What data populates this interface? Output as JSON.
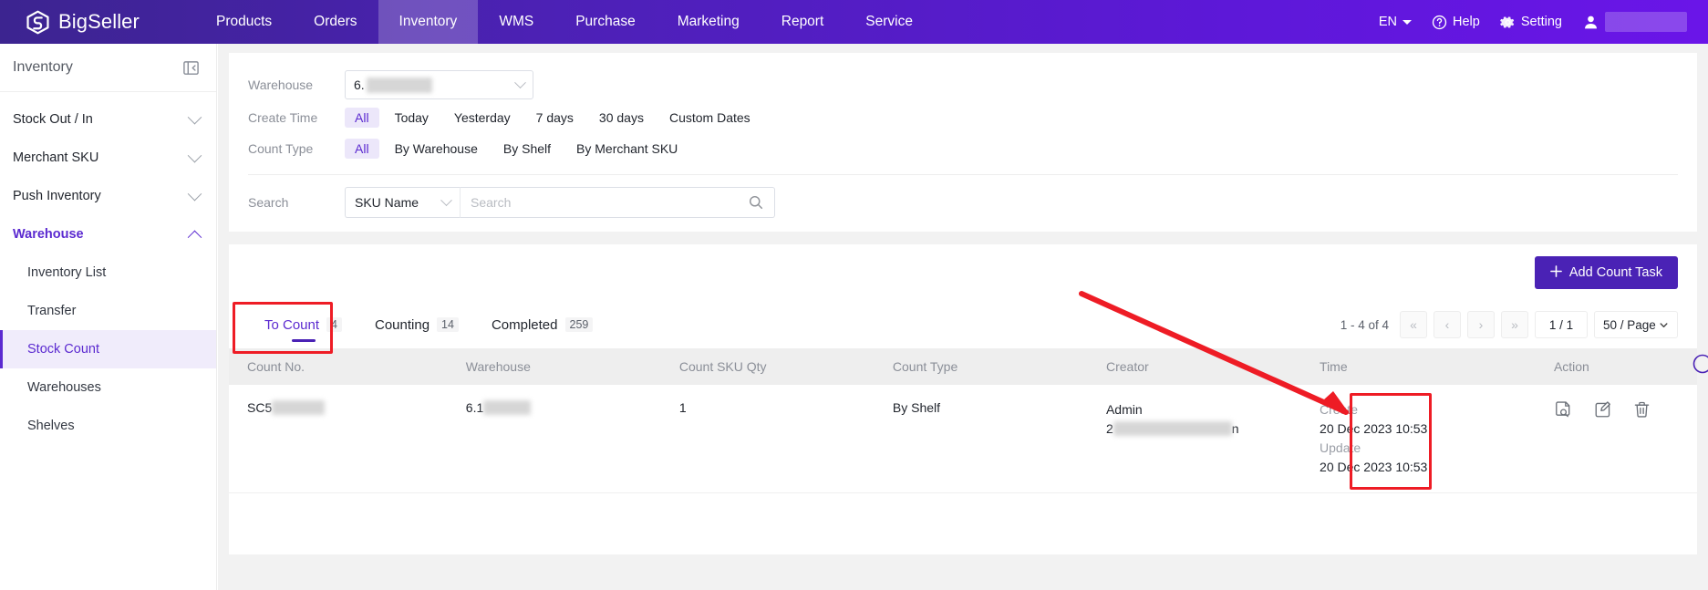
{
  "header": {
    "brand": "BigSeller",
    "brand_icon": "bigseller-logo-icon",
    "nav": [
      {
        "label": "Products",
        "active": false
      },
      {
        "label": "Orders",
        "active": false
      },
      {
        "label": "Inventory",
        "active": true
      },
      {
        "label": "WMS",
        "active": false
      },
      {
        "label": "Purchase",
        "active": false
      },
      {
        "label": "Marketing",
        "active": false
      },
      {
        "label": "Report",
        "active": false
      },
      {
        "label": "Service",
        "active": false
      }
    ],
    "language": "EN",
    "help": "Help",
    "setting": "Setting",
    "account_name": ""
  },
  "sidebar": {
    "title": "Inventory",
    "groups": [
      {
        "label": "Stock Out / In",
        "open": false
      },
      {
        "label": "Merchant SKU",
        "open": false
      },
      {
        "label": "Push Inventory",
        "open": false
      },
      {
        "label": "Warehouse",
        "open": true
      }
    ],
    "sub_items": [
      {
        "label": "Inventory List",
        "active": false
      },
      {
        "label": "Transfer",
        "active": false
      },
      {
        "label": "Stock Count",
        "active": true
      },
      {
        "label": "Warehouses",
        "active": false
      },
      {
        "label": "Shelves",
        "active": false
      }
    ]
  },
  "filters": {
    "warehouse_label": "Warehouse",
    "warehouse_value": "6.",
    "create_time_label": "Create Time",
    "create_time_options": [
      "All",
      "Today",
      "Yesterday",
      "7 days",
      "30 days",
      "Custom Dates"
    ],
    "create_time_selected": "All",
    "count_type_label": "Count Type",
    "count_type_options": [
      "All",
      "By Warehouse",
      "By Shelf",
      "By Merchant SKU"
    ],
    "count_type_selected": "All",
    "search_label": "Search",
    "search_type": "SKU Name",
    "search_placeholder": "Search",
    "search_value": ""
  },
  "toolbar": {
    "add_count_task": "Add Count Task",
    "add_icon": "plus-icon"
  },
  "tabs": [
    {
      "label": "To Count",
      "count": "4",
      "active": true
    },
    {
      "label": "Counting",
      "count": "14",
      "active": false
    },
    {
      "label": "Completed",
      "count": "259",
      "active": false
    }
  ],
  "pagination": {
    "range": "1 - 4 of 4",
    "first": "«",
    "prev": "‹",
    "next": "›",
    "last": "»",
    "current": "1 / 1",
    "page_size": "50 / Page"
  },
  "table": {
    "columns": [
      "Count No.",
      "Warehouse",
      "Count SKU Qty",
      "Count Type",
      "Creator",
      "Time",
      "Action"
    ],
    "rows": [
      {
        "count_no_prefix": "SC5",
        "count_no_redacted": true,
        "warehouse_prefix": "6.1",
        "warehouse_redacted": true,
        "count_sku_qty": "1",
        "count_type": "By Shelf",
        "creator_name": "Admin",
        "creator_id_prefix": "2",
        "creator_id_suffix": "n",
        "creator_redacted": true,
        "create_label": "Create",
        "create_time": "20 Dec 2023 10:53",
        "update_label": "Update",
        "update_time": "20 Dec 2023 10:53",
        "actions": [
          {
            "name": "count-detail-icon",
            "title": "Count Detail"
          },
          {
            "name": "edit-icon",
            "title": "Edit"
          },
          {
            "name": "delete-icon",
            "title": "Delete"
          }
        ]
      }
    ]
  },
  "annotations": {
    "color": "#ee1c25",
    "boxes": [
      "to-count-tab-highlight",
      "row-action-highlight"
    ],
    "arrow": "arrow-pointing-to-actions"
  },
  "colors": {
    "brand_purple": "#4a22b5",
    "accent_purple": "#5b2ad0",
    "chip_active_bg": "#ece7fa",
    "page_bg": "#f2f2f2",
    "annotation_red": "#ee1c25"
  }
}
